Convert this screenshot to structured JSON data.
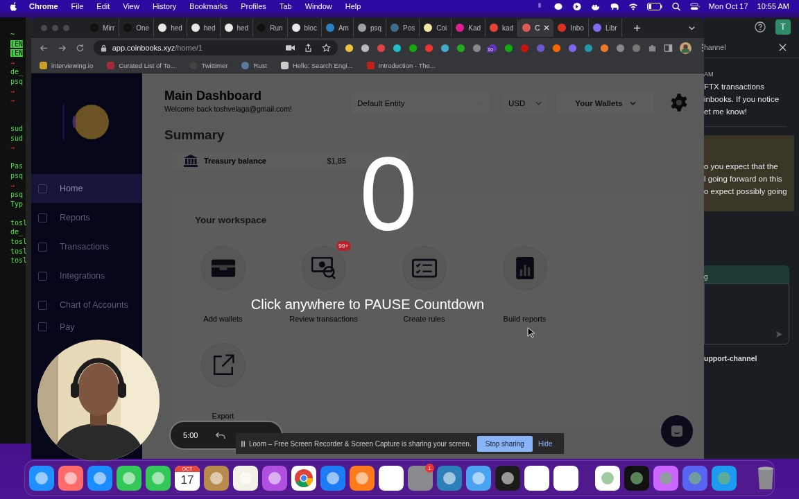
{
  "menubar": {
    "app": "Chrome",
    "items": [
      "File",
      "Edit",
      "View",
      "History",
      "Bookmarks",
      "Profiles",
      "Tab",
      "Window",
      "Help"
    ],
    "date": "Mon Oct 17",
    "time": "10:55 AM"
  },
  "terminal": {
    "lines": [
      {
        "kind": "text",
        "text": "~"
      },
      {
        "kind": "mark",
        "text": "(EN"
      },
      {
        "kind": "mark",
        "text": "(EN"
      },
      {
        "kind": "arrow",
        "text": "→"
      },
      {
        "kind": "text",
        "text": "de_"
      },
      {
        "kind": "text",
        "text": "psq"
      },
      {
        "kind": "arrow",
        "text": "→"
      },
      {
        "kind": "arrow",
        "text": "→"
      },
      {
        "kind": "blank"
      },
      {
        "kind": "blank"
      },
      {
        "kind": "text",
        "text": "sud"
      },
      {
        "kind": "text",
        "text": "sud"
      },
      {
        "kind": "arrow",
        "text": "→"
      },
      {
        "kind": "blank"
      },
      {
        "kind": "text",
        "text": "Pas"
      },
      {
        "kind": "text",
        "text": "psq"
      },
      {
        "kind": "arrow",
        "text": "→"
      },
      {
        "kind": "text",
        "text": "psq"
      },
      {
        "kind": "text",
        "text": "Typ"
      },
      {
        "kind": "blank"
      },
      {
        "kind": "text",
        "text": "tosl"
      },
      {
        "kind": "text",
        "text": "de_"
      },
      {
        "kind": "text",
        "text": "tosl"
      },
      {
        "kind": "text",
        "text": "tosl"
      },
      {
        "kind": "text",
        "text": "tosl"
      }
    ]
  },
  "browser": {
    "tabs": [
      {
        "label": "Mirr",
        "selected": false,
        "color": "#111111"
      },
      {
        "label": "One",
        "selected": false,
        "color": "#111111"
      },
      {
        "label": "hed",
        "selected": false,
        "color": "#e8e8e8"
      },
      {
        "label": "hed",
        "selected": false,
        "color": "#e8e8e8"
      },
      {
        "label": "hed",
        "selected": false,
        "color": "#e8e8e8"
      },
      {
        "label": "Run",
        "selected": false,
        "color": "#111111"
      },
      {
        "label": "bloc",
        "selected": false,
        "color": "#e8e8e8"
      },
      {
        "label": "Am",
        "selected": false,
        "color": "#2f7fc1"
      },
      {
        "label": "psq",
        "selected": false,
        "color": "#9aa0a6"
      },
      {
        "label": "Pos",
        "selected": false,
        "color": "#3f6b8f"
      },
      {
        "label": "Coi",
        "selected": false,
        "color": "#f3e7a8"
      },
      {
        "label": "Kad",
        "selected": false,
        "color": "#e0208a"
      },
      {
        "label": "kad",
        "selected": false,
        "color": "#ea4335"
      },
      {
        "label": "C",
        "selected": true,
        "color": "#e05a5a"
      },
      {
        "label": "Inbo",
        "selected": false,
        "color": "#d93025"
      },
      {
        "label": "Libr",
        "selected": false,
        "color": "#7b6cf6"
      }
    ],
    "address": {
      "host": "app.coinbooks.xyz",
      "path": "/home/1"
    },
    "extension_badge": "10",
    "bookmarks": [
      "interviewing.io",
      "Curated List of To...",
      "Twittimer",
      "Rust",
      "Hello: Search Engi...",
      "Introduction - The..."
    ]
  },
  "app": {
    "sidebar": [
      {
        "label": "Home",
        "selected": true
      },
      {
        "label": "Reports",
        "selected": false
      },
      {
        "label": "Transactions",
        "selected": false
      },
      {
        "label": "Integrations",
        "selected": false
      },
      {
        "label": "Chart of Accounts",
        "selected": false
      },
      {
        "label": "Pay",
        "selected": false
      }
    ],
    "title": "Main Dashboard",
    "welcome": "Welcome back toshvelaga@gmail.com!",
    "entity": "Default Entity",
    "currency": "USD",
    "wallets": "Your Wallets",
    "summary": "Summary",
    "treasury_label": "Treasury balance",
    "treasury_value": "$1,85",
    "workspace_title": "Your workspace",
    "tiles": [
      {
        "kind": "wallet",
        "label": "Add wallets"
      },
      {
        "kind": "review",
        "label": "Review transactions",
        "badge": "99+"
      },
      {
        "kind": "rules",
        "label": "Create rules"
      },
      {
        "kind": "reports",
        "label": "Build reports"
      },
      {
        "kind": "export",
        "label": "Export"
      }
    ]
  },
  "countdown": {
    "number": "0",
    "hint": "Click anywhere to PAUSE Countdown"
  },
  "chat_panel": {
    "avatar": "T",
    "header": "hannel",
    "time": "AM",
    "message": [
      "FTX transactions",
      "inbooks. If you notice",
      "et me know!"
    ],
    "highlight": [
      "o you expect that the",
      "l going forward on this",
      "o expect possibly going"
    ],
    "composer_banner": "g",
    "footer": "upport-channel"
  },
  "loom": {
    "timer": "5:00",
    "notice": "Loom – Free Screen Recorder & Screen Capture is sharing your screen.",
    "stop": "Stop sharing",
    "hide": "Hide"
  },
  "dock": {
    "calendar_month": "OCT",
    "calendar_day": "17",
    "settings_badge": "1"
  }
}
